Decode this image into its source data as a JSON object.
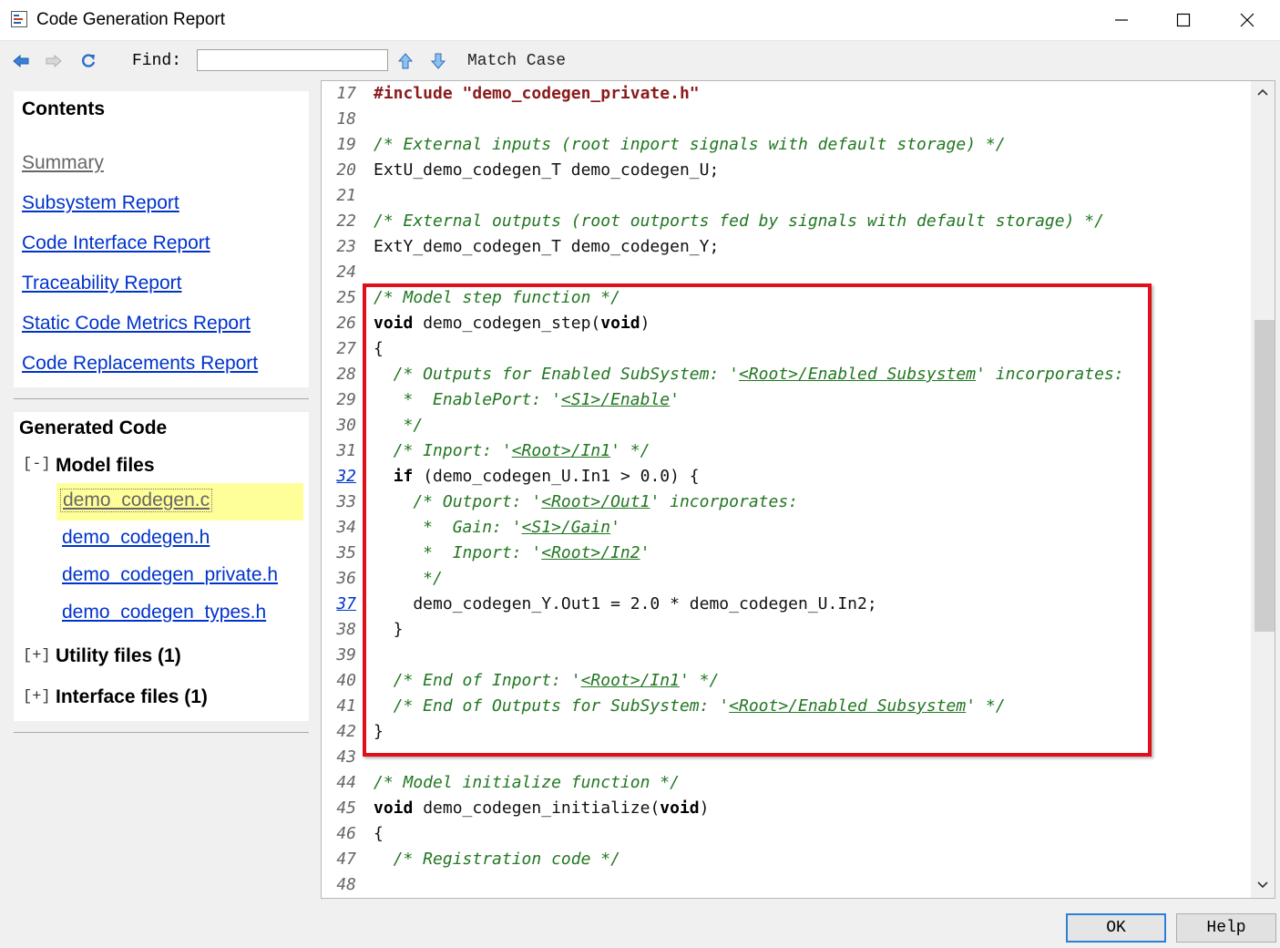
{
  "window": {
    "title": "Code Generation Report",
    "controls": [
      "minimize",
      "maximize",
      "close"
    ]
  },
  "toolbar": {
    "back_icon": "back-arrow-icon",
    "forward_icon": "forward-arrow-icon",
    "refresh_icon": "refresh-icon",
    "find_label": "Find:",
    "find_value": "",
    "find_up_icon": "arrow-up-icon",
    "find_down_icon": "arrow-down-icon",
    "match_case_label": "Match Case"
  },
  "contents": {
    "title": "Contents",
    "links": [
      {
        "label": "Summary",
        "visited": true
      },
      {
        "label": "Subsystem Report"
      },
      {
        "label": "Code Interface Report"
      },
      {
        "label": "Traceability Report"
      },
      {
        "label": "Static Code Metrics Report"
      },
      {
        "label": "Code Replacements Report"
      }
    ]
  },
  "generated_code": {
    "title": "Generated Code",
    "model_files": {
      "toggle": "[-]",
      "label": "Model files",
      "files": [
        "demo_codegen.c",
        "demo_codegen.h",
        "demo_codegen_private.h",
        "demo_codegen_types.h"
      ],
      "selected": "demo_codegen.c"
    },
    "utility_files": {
      "toggle": "[+]",
      "label": "Utility files (1)"
    },
    "interface_files": {
      "toggle": "[+]",
      "label": "Interface files (1)"
    }
  },
  "code": {
    "lines": [
      {
        "n": "17",
        "t": "#include \"demo_codegen_private.h\""
      },
      {
        "n": "18",
        "t": ""
      },
      {
        "n": "19",
        "t": "/* External inputs (root inport signals with default storage) */"
      },
      {
        "n": "20",
        "t": "ExtU_demo_codegen_T demo_codegen_U;"
      },
      {
        "n": "21",
        "t": ""
      },
      {
        "n": "22",
        "t": "/* External outputs (root outports fed by signals with default storage) */"
      },
      {
        "n": "23",
        "t": "ExtY_demo_codegen_T demo_codegen_Y;"
      },
      {
        "n": "24",
        "t": ""
      },
      {
        "n": "25",
        "t": "/* Model step function */"
      },
      {
        "n": "26",
        "t": "void demo_codegen_step(void)"
      },
      {
        "n": "27",
        "t": "{"
      },
      {
        "n": "28",
        "t": "  /* Outputs for Enabled SubSystem: '<Root>/Enabled Subsystem' incorporates:"
      },
      {
        "n": "29",
        "t": "   *  EnablePort: '<S1>/Enable'"
      },
      {
        "n": "30",
        "t": "   */"
      },
      {
        "n": "31",
        "t": "  /* Inport: '<Root>/In1' */"
      },
      {
        "n": "32",
        "t": "  if (demo_codegen_U.In1 > 0.0) {",
        "link": true
      },
      {
        "n": "33",
        "t": "    /* Outport: '<Root>/Out1' incorporates:"
      },
      {
        "n": "34",
        "t": "     *  Gain: '<S1>/Gain'"
      },
      {
        "n": "35",
        "t": "     *  Inport: '<Root>/In2'"
      },
      {
        "n": "36",
        "t": "     */"
      },
      {
        "n": "37",
        "t": "    demo_codegen_Y.Out1 = 2.0 * demo_codegen_U.In2;",
        "link": true
      },
      {
        "n": "38",
        "t": "  }"
      },
      {
        "n": "39",
        "t": ""
      },
      {
        "n": "40",
        "t": "  /* End of Inport: '<Root>/In1' */"
      },
      {
        "n": "41",
        "t": "  /* End of Outputs for SubSystem: '<Root>/Enabled Subsystem' */"
      },
      {
        "n": "42",
        "t": "}"
      },
      {
        "n": "43",
        "t": ""
      },
      {
        "n": "44",
        "t": "/* Model initialize function */"
      },
      {
        "n": "45",
        "t": "void demo_codegen_initialize(void)"
      },
      {
        "n": "46",
        "t": "{"
      },
      {
        "n": "47",
        "t": "  /* Registration code */"
      },
      {
        "n": "48",
        "t": ""
      }
    ]
  },
  "buttons": {
    "ok": "OK",
    "help": "Help"
  },
  "colors": {
    "highlight_box": "#e0101b",
    "link": "#0033cc",
    "comment": "#227722",
    "selected_file_bg": "#ffff99"
  }
}
